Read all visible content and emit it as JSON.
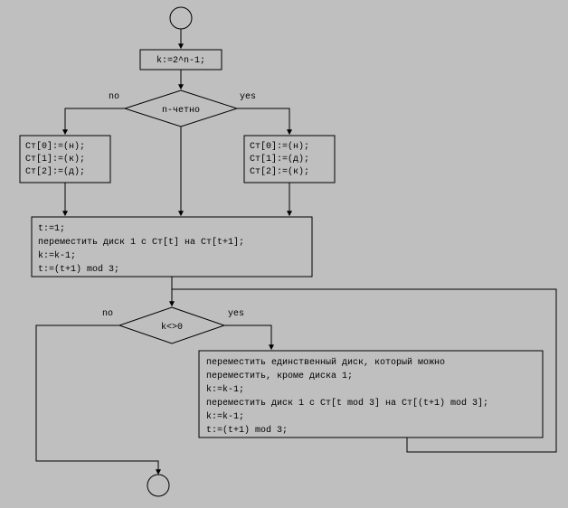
{
  "nodes": {
    "process1": "k:=2^n-1;",
    "decision1": "n-четно",
    "decision1_no": "no",
    "decision1_yes": "yes",
    "leftbox_l1": "Ст[0]:=(н);",
    "leftbox_l2": "Ст[1]:=(к);",
    "leftbox_l3": "Ст[2]:=(д);",
    "rightbox_l1": "Ст[0]:=(н);",
    "rightbox_l2": "Ст[1]:=(д);",
    "rightbox_l3": "Ст[2]:=(к);",
    "loopinit_l1": "t:=1;",
    "loopinit_l2": "переместить диск 1 с Ст[t] на Ст[t+1];",
    "loopinit_l3": "k:=k-1;",
    "loopinit_l4": "t:=(t+1) mod 3;",
    "decision2": "k<>0",
    "decision2_no": "no",
    "decision2_yes": "yes",
    "loopbody_l1": "переместить единственный диск, который можно",
    "loopbody_l2": "переместить, кроме диска 1;",
    "loopbody_l3": "k:=k-1;",
    "loopbody_l4": "переместить диск 1 с Ст[t mod 3] на Ст[(t+1) mod 3];",
    "loopbody_l5": "k:=k-1;",
    "loopbody_l6": "t:=(t+1) mod 3;"
  }
}
